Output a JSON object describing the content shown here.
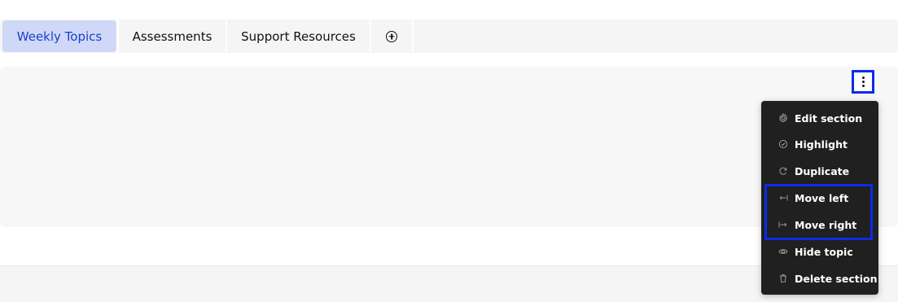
{
  "tabs": {
    "items": [
      {
        "label": "Weekly Topics",
        "active": true
      },
      {
        "label": "Assessments",
        "active": false
      },
      {
        "label": "Support Resources",
        "active": false
      }
    ],
    "add_icon": "plus-circle-icon"
  },
  "section": {
    "menu_button_icon": "vertical-ellipsis-icon"
  },
  "context_menu": {
    "items": [
      {
        "label": "Edit section",
        "icon": "gear-icon"
      },
      {
        "label": "Highlight",
        "icon": "check-circle-icon"
      },
      {
        "label": "Duplicate",
        "icon": "refresh-icon"
      },
      {
        "label": "Move left",
        "icon": "arrow-left-bar-icon"
      },
      {
        "label": "Move right",
        "icon": "arrow-right-bar-icon"
      },
      {
        "label": "Hide topic",
        "icon": "eye-icon"
      },
      {
        "label": "Delete section",
        "icon": "trash-icon"
      }
    ]
  },
  "colors": {
    "accent": "#0a2ce8",
    "active_tab_bg": "#cfd9f7",
    "active_tab_text": "#1a3fcc",
    "menu_bg": "#202020"
  }
}
